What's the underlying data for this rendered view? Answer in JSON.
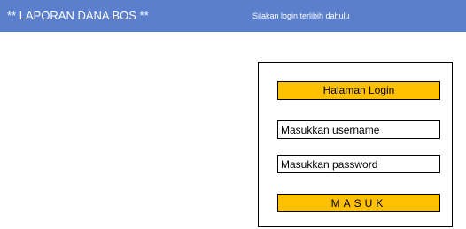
{
  "header": {
    "title": "** LAPORAN DANA BOS **",
    "message": "Silakan login terlibih dahulu"
  },
  "login": {
    "title": "Halaman Login",
    "username_placeholder": "Masukkan username",
    "password_placeholder": "Masukkan password",
    "submit_label": "MASUK"
  },
  "colors": {
    "header_bg": "#5b7fcb",
    "accent": "#ffc000"
  }
}
